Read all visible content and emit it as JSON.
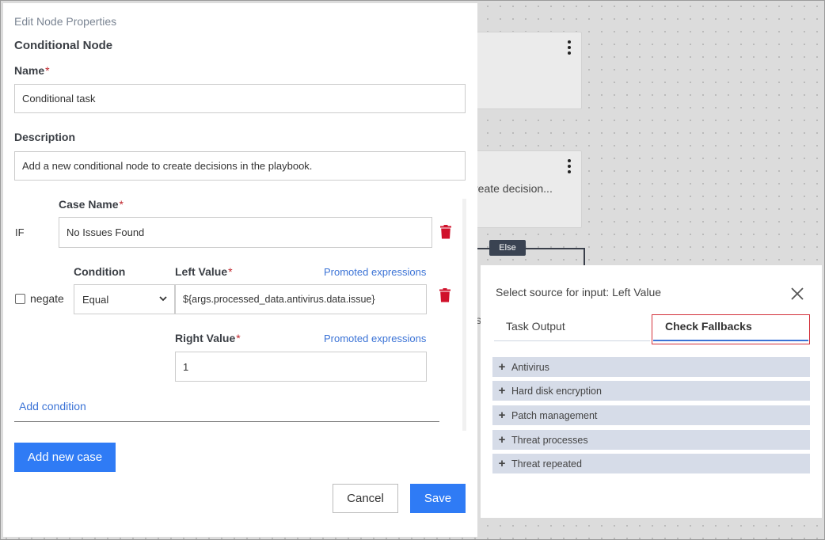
{
  "canvas": {
    "node2_text": "reate decision...",
    "else_label": "Else",
    "partial_char": "s"
  },
  "edit_panel": {
    "header": "Edit Node Properties",
    "node_type": "Conditional Node",
    "name_label": "Name",
    "name_value": "Conditional task",
    "description_label": "Description",
    "description_value": "Add a new conditional node to create decisions in the playbook.",
    "case": {
      "if_label": "IF",
      "case_name_label": "Case Name",
      "case_name_value": "No Issues Found",
      "negate_label": "negate",
      "condition_label": "Condition",
      "condition_value": "Equal",
      "left_value_label": "Left Value",
      "left_value": "${args.processed_data.antivirus.data.issue}",
      "right_value_label": "Right Value",
      "right_value": "1",
      "promoted_expressions": "Promoted expressions",
      "add_condition": "Add condition"
    },
    "required_mark": "*",
    "add_new_case": "Add new case",
    "cancel": "Cancel",
    "save": "Save"
  },
  "source_panel": {
    "title": "Select source for input: Left Value",
    "tabs": [
      {
        "label": "Task Output",
        "active": false
      },
      {
        "label": "Check Fallbacks",
        "active": true
      }
    ],
    "items": [
      {
        "label": "Antivirus",
        "icon": "plus-icon"
      },
      {
        "label": "Hard disk encryption",
        "icon": "plus-icon"
      },
      {
        "label": "Patch management",
        "icon": "plus-icon"
      },
      {
        "label": "Threat processes",
        "icon": "plus-icon"
      },
      {
        "label": "Threat repeated",
        "icon": "plus-icon"
      }
    ]
  },
  "colors": {
    "primary": "#2f7bf5",
    "link": "#3b73d6",
    "danger": "#d0112b",
    "accordion": "#d6dce8"
  }
}
